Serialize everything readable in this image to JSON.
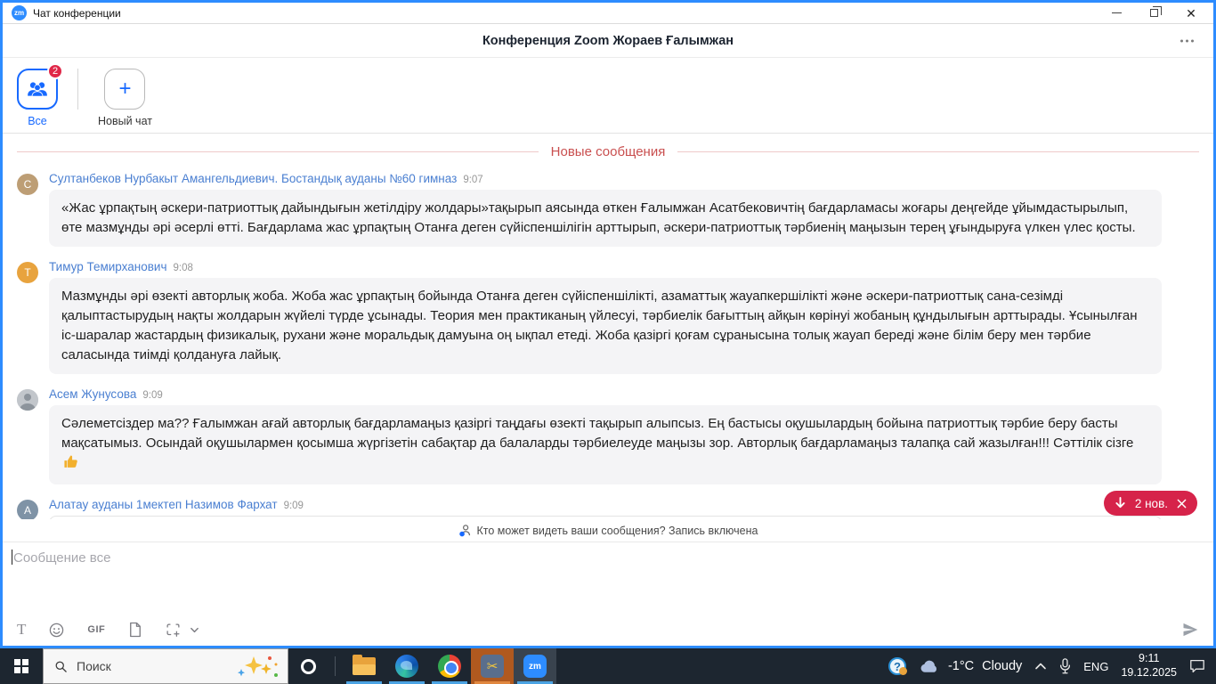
{
  "window": {
    "title": "Чат конференции",
    "logo": "zm"
  },
  "header": {
    "title": "Конференция Zoom Жораев Ғалымжан"
  },
  "tabs": {
    "all": {
      "label": "Все",
      "badge": "2"
    },
    "new_chat": {
      "label": "Новый чат"
    }
  },
  "icons": {
    "plus": "+",
    "close": "✕",
    "format_text": "T",
    "gif": "GIF",
    "scissors": "✂"
  },
  "chat": {
    "divider_label": "Новые сообщения",
    "messages": [
      {
        "initial": "C",
        "sender": "Султанбеков Нурбакыт Амангельдиевич. Бостандық ауданы №60 гимназ",
        "time": "9:07",
        "text": "«Жас ұрпақтың әскери-патриоттық дайындығын жетілдіру жолдары»тақырып аясында өткен Ғалымжан Асатбековичтің бағдарламасы жоғары деңгейде ұйымдастырылып, өте мазмұнды әрі әсерлі өтті. Бағдарлама жас ұрпақтың Отанға деген сүйіспеншілігін арттырып, әскери-патриоттық тәрбиенің маңызын терең ұғындыруға үлкен үлес қосты."
      },
      {
        "initial": "T",
        "sender": "Тимур Темирханович",
        "time": "9:08",
        "text": "Мазмұнды әрі өзекті авторлық жоба. Жоба жас ұрпақтың бойында Отанға деген сүйіспеншілікті, азаматтық жауапкершілікті және әскери-патриоттық сана-сезімді қалыптастырудың нақты жолдарын жүйелі түрде ұсынады. Теория мен практиканың үйлесуі, тәрбиелік бағыттың айқын көрінуі жобаның құндылығын арттырады. Ұсынылған іс-шаралар жастардың физикалық, рухани және моральдық дамуына оң ықпал етеді. Жоба қазіргі қоғам сұранысына толық жауап береді және білім беру мен тәрбие саласында тиімді қолдануға лайық."
      },
      {
        "initial": "",
        "sender": "Асем Жунусова",
        "time": "9:09",
        "text": "Сәлеметсіздер ма??  Ғалымжан ағай авторлық бағдарламаңыз  қазіргі таңдағы өзекті тақырып алыпсыз. Ең бастысы оқушылардың бойына патриоттық тәрбие беру басты мақсатымыз. Осындай оқушылармен қосымша жүргізетін сабақтар да балаларды тәрбиелеуде маңызы зор. Авторлық бағдарламаңыз талапқа сай жазылған!!!  Сәттілік сізге"
      },
      {
        "initial": "A",
        "sender": "Алатау ауданы 1мектеп Назимов Фархат",
        "time": "9:09",
        "text": ""
      }
    ],
    "new_pill_label": "2 нов.",
    "privacy_note": "Кто может видеть ваши сообщения? Запись включена"
  },
  "composer": {
    "placeholder": "Сообщение все"
  },
  "taskbar": {
    "search_placeholder": "Поиск",
    "zoom_logo": "zm",
    "weather": {
      "temp": "-1°C",
      "condition": "Cloudy"
    },
    "language": "ENG",
    "clock": {
      "time": "9:11",
      "date": "19.12.2025"
    }
  },
  "colors": {
    "accent_blue": "#2D8CFF",
    "tab_blue": "#1769ff",
    "badge_red": "#e02849",
    "pill_red": "#d6234a",
    "divider_red": "#c94f4f",
    "sender_blue": "#4a7fd1",
    "taskbar_bg": "#1d2630"
  }
}
